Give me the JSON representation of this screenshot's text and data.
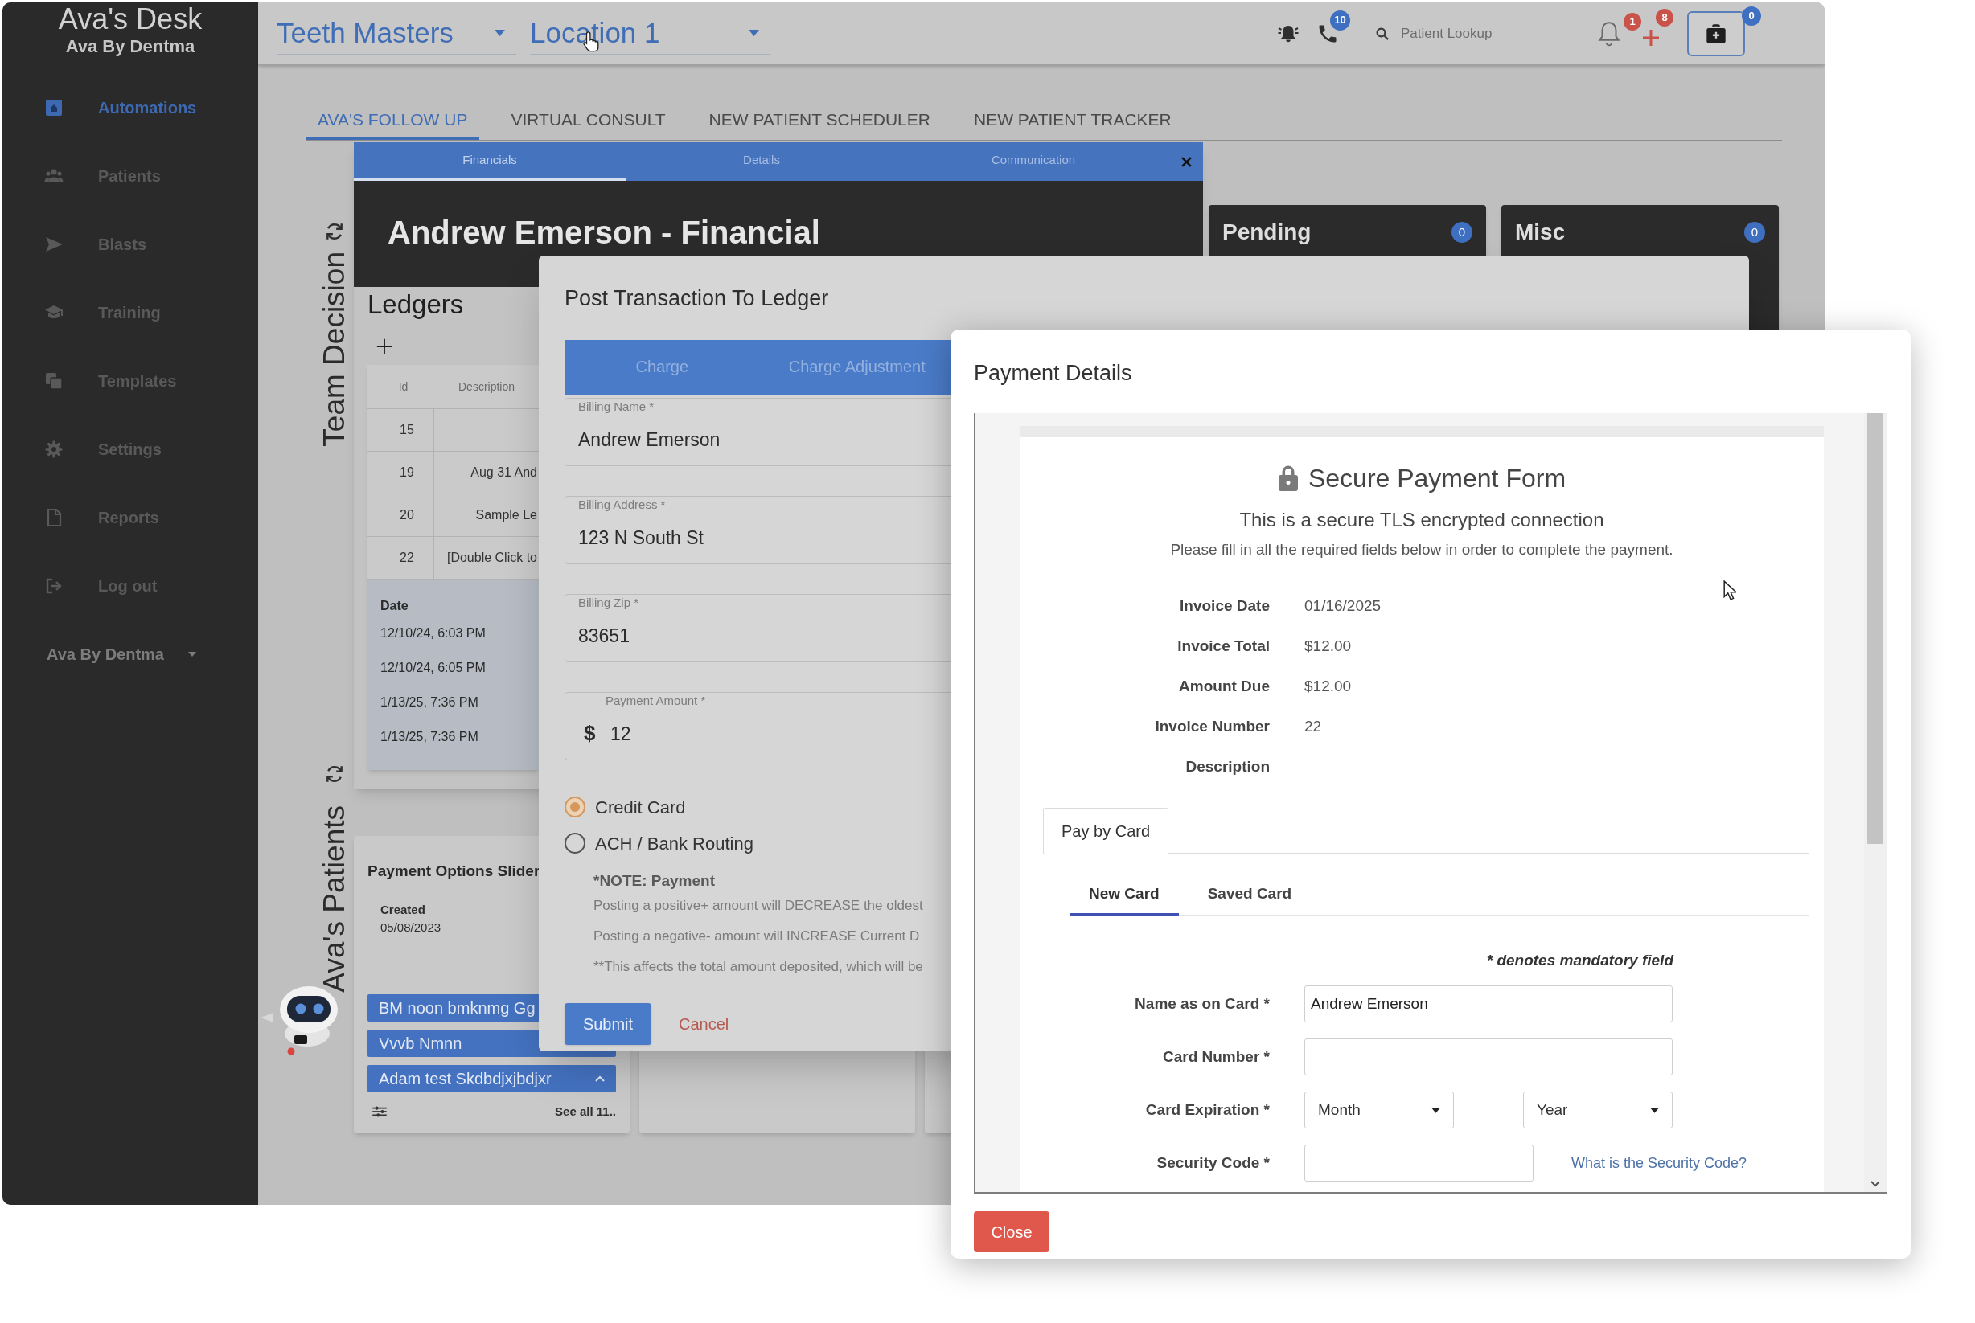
{
  "sidebar": {
    "title": "Ava's Desk",
    "subtitle": "Ava By Dentma",
    "items": [
      {
        "label": "Automations",
        "selected": true
      },
      {
        "label": "Patients",
        "selected": false
      },
      {
        "label": "Blasts",
        "selected": false
      },
      {
        "label": "Training",
        "selected": false
      },
      {
        "label": "Templates",
        "selected": false
      },
      {
        "label": "Settings",
        "selected": false
      },
      {
        "label": "Reports",
        "selected": false
      },
      {
        "label": "Log out",
        "selected": false
      }
    ],
    "account": "Ava By Dentma"
  },
  "top_bar": {
    "practice": "Teeth Masters",
    "location": "Location 1",
    "calls_badge": "10",
    "search": {
      "placeholder": "Patient Lookup"
    },
    "notifications_badge": "1",
    "add_badge": "8",
    "briefcase_badge": "0"
  },
  "tabs": [
    {
      "label": "AVA'S FOLLOW UP",
      "selected": true
    },
    {
      "label": "VIRTUAL CONSULT",
      "selected": false
    },
    {
      "label": "NEW PATIENT SCHEDULER",
      "selected": false
    },
    {
      "label": "NEW PATIENT TRACKER",
      "selected": false
    }
  ],
  "board": {
    "team_decision": {
      "label": "Team Decision",
      "columns": [
        {
          "title": "Pending",
          "count": "0"
        },
        {
          "title": "Misc",
          "count": "0"
        }
      ]
    },
    "avas_patients": {
      "label": "Ava's Patients",
      "payment_options": {
        "title": "Payment Options Slider",
        "created_label": "Created",
        "created_date": "05/08/2023",
        "patients": [
          {
            "name": "BM noon bmknmg Gg"
          },
          {
            "name": "Vvvb Nmnn"
          },
          {
            "name": "Adam test Skdbdjxjbdjxr",
            "expanded": true
          }
        ],
        "see_all": "See all 11.."
      }
    }
  },
  "financial_window": {
    "tabs": [
      {
        "label": "Financials",
        "selected": true
      },
      {
        "label": "Details",
        "selected": false
      },
      {
        "label": "Communication",
        "selected": false
      }
    ],
    "title": "Andrew Emerson - Financial",
    "ledgers": {
      "title": "Ledgers",
      "columns": [
        "Id",
        "Description"
      ],
      "rows": [
        {
          "id": "15"
        },
        {
          "id": "19",
          "description": "Aug 31 And"
        },
        {
          "id": "20",
          "description": "Sample Le"
        },
        {
          "id": "22",
          "description": "[Double Click to"
        }
      ],
      "date_heading": "Date",
      "dates": [
        "12/10/24, 6:03 PM",
        "12/10/24, 6:05 PM",
        "1/13/25, 7:36 PM",
        "1/13/25, 7:36 PM"
      ]
    }
  },
  "post_transaction": {
    "title": "Post Transaction To Ledger",
    "tabs": [
      {
        "label": "Charge",
        "selected": false
      },
      {
        "label": "Charge Adjustment",
        "selected": false
      }
    ],
    "fields": [
      {
        "label": "Billing Name *",
        "value": "Andrew Emerson"
      },
      {
        "label": "Billing Address *",
        "value": "123 N South St"
      },
      {
        "label": "Billing Zip *",
        "value": "83651"
      },
      {
        "label": "Payment Amount *",
        "prefix": "$",
        "value": "12"
      }
    ],
    "payment_methods": [
      {
        "label": "Credit Card",
        "selected": true
      },
      {
        "label": "ACH / Bank Routing",
        "selected": false
      }
    ],
    "note_title": "*NOTE: Payment",
    "notes": [
      "Posting a positive+ amount will DECREASE the oldest",
      "Posting a negative- amount will INCREASE Current D",
      "**This affects the total amount deposited, which will be"
    ],
    "submit": "Submit",
    "cancel": "Cancel"
  },
  "payment_details": {
    "title": "Payment Details",
    "form": {
      "heading": "Secure Payment Form",
      "subheading": "This is a secure TLS encrypted connection",
      "instructions": "Please fill in all the required fields below in order to complete the payment.",
      "invoice": [
        {
          "label": "Invoice Date",
          "value": "01/16/2025"
        },
        {
          "label": "Invoice Total",
          "value": "$12.00"
        },
        {
          "label": "Amount Due",
          "value": "$12.00"
        },
        {
          "label": "Invoice Number",
          "value": "22"
        },
        {
          "label": "Description"
        }
      ],
      "method_tabs": [
        {
          "label": "Pay by Card",
          "selected": true
        }
      ],
      "card_tabs": [
        {
          "label": "New Card",
          "selected": true
        },
        {
          "label": "Saved Card",
          "selected": false
        }
      ],
      "mandatory_note": "* denotes mandatory field",
      "fields": [
        {
          "kind": "text",
          "label": "Name as on Card *",
          "value": "Andrew Emerson"
        },
        {
          "kind": "text",
          "label": "Card Number *"
        },
        {
          "kind": "select",
          "label": "Card Expiration *",
          "selects": [
            "Month",
            "Year"
          ]
        },
        {
          "kind": "text",
          "label": "Security Code *",
          "link": "What is the Security Code?"
        }
      ]
    },
    "close": "Close"
  }
}
